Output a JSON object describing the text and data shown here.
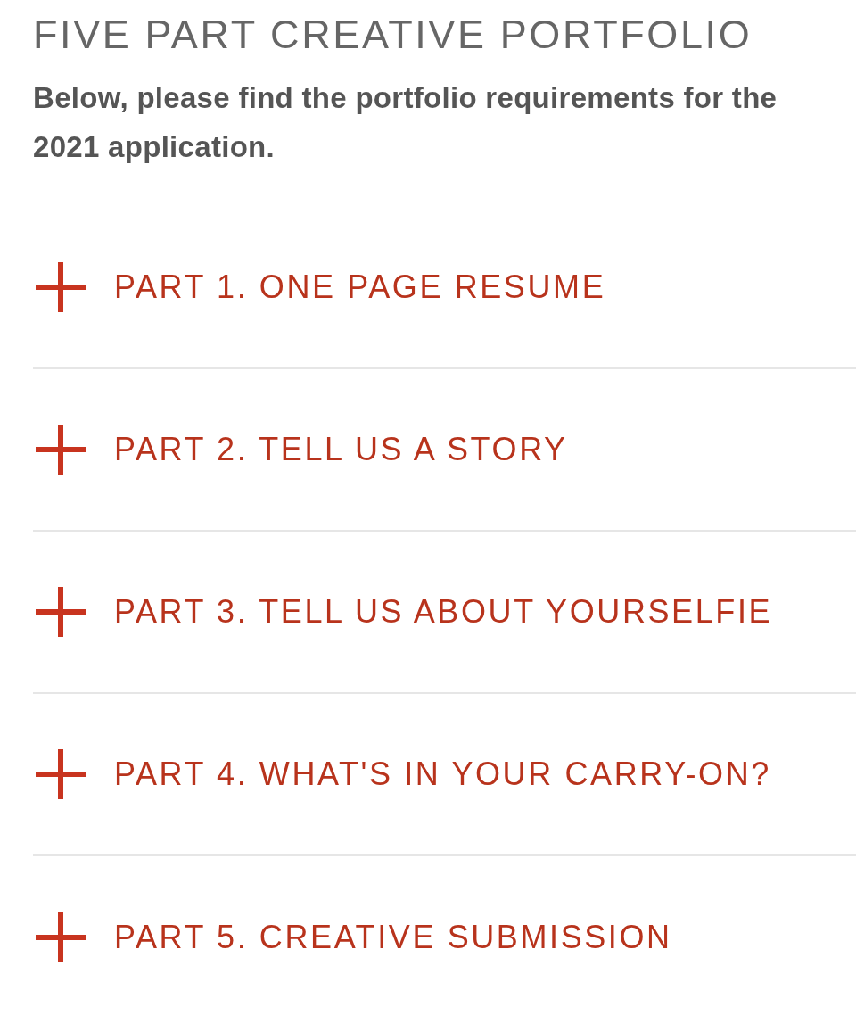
{
  "title": "FIVE PART CREATIVE PORTFOLIO",
  "intro": "Below, please find the portfolio requirements for the 2021 application.",
  "sections": [
    {
      "label": "PART 1. ONE PAGE RESUME",
      "expanded": false
    },
    {
      "label": "PART 2. TELL US A STORY",
      "expanded": false
    },
    {
      "label": "PART 3. TELL US ABOUT YOURSELFIE",
      "expanded": false
    },
    {
      "label": "PART 4. WHAT'S IN YOUR CARRY-ON?",
      "expanded": false
    },
    {
      "label": "PART 5. CREATIVE SUBMISSION",
      "expanded": false
    }
  ]
}
